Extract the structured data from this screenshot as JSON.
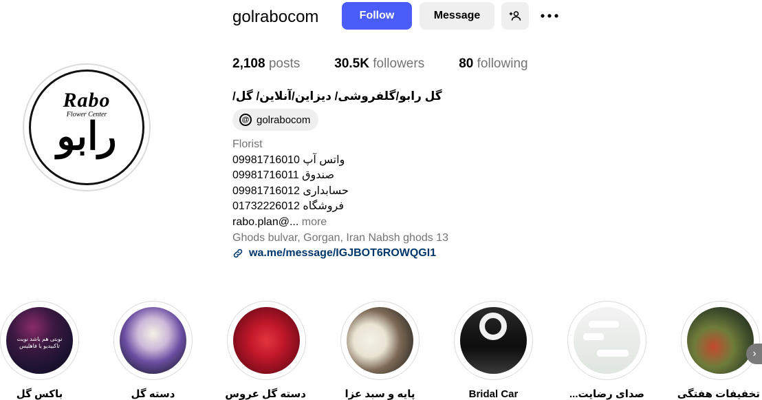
{
  "profile": {
    "username": "golrabocom",
    "avatar_logo": {
      "en": "Rabo",
      "sub": "Flower Center",
      "fa": "رابو"
    }
  },
  "actions": {
    "follow_label": "Follow",
    "message_label": "Message",
    "add_user_icon": "add-person-icon",
    "more_icon": "more-horizontal-icon"
  },
  "stats": {
    "posts_count": "2,108",
    "posts_label": "posts",
    "followers_count": "30.5K",
    "followers_label": "followers",
    "following_count": "80",
    "following_label": "following"
  },
  "bio": {
    "full_name": "گل رابو/گلفروشی/ دیزاین/آنلاین/ گل/",
    "threads_handle": "golrabocom",
    "category": "Florist",
    "lines": [
      "09981716010 واتس آپ",
      "09981716011 صندوق",
      "09981716012 حسابداری",
      "01732226012 فروشگاه"
    ],
    "truncated": "rabo.plan@...",
    "more_label": "more",
    "address": "Ghods bulvar, Gorgan, Iran Nabsh ghods 13",
    "link": "wa.me/message/IGJBOT6ROWQGI1"
  },
  "highlights": [
    {
      "label": "باکس گل",
      "overlay": "نوبتی هم باشد نوبت تاکبیدیو یا فاهلیس"
    },
    {
      "label": "دسته گل"
    },
    {
      "label": "دسته گل عروس"
    },
    {
      "label": "پایه و سبد عزا"
    },
    {
      "label": "Bridal Car"
    },
    {
      "label": "صدای رضایت..."
    },
    {
      "label": "تخفیفات هفتگی"
    }
  ],
  "highlights_next_icon": "chevron-right-icon"
}
